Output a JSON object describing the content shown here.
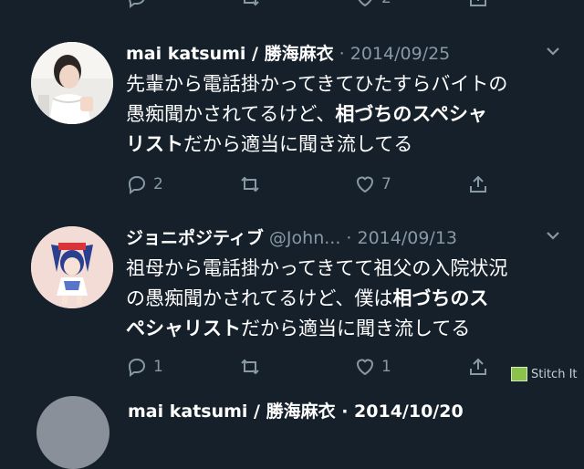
{
  "top_partial": {
    "like_count": "2"
  },
  "tweets": [
    {
      "name": "mai katsumi / 勝海麻衣",
      "handle": "",
      "date": "· 2014/09/25",
      "body": {
        "line1": "先輩から電話掛かってきてひたすらバイトの",
        "line2_plain": "愚痴聞かされてるけど、",
        "line2_bold": "相づちのスペシャ",
        "line3_bold": "リスト",
        "line3_plain": "だから適当に聞き流してる"
      },
      "reply_count": "2",
      "retweet_count": "",
      "like_count": "7"
    },
    {
      "name": "ジョニポジティブ",
      "handle": "@John...",
      "date": "· 2014/09/13",
      "body": {
        "line1": "祖母から電話掛かってきてて祖父の入院状況",
        "line2_plain": "の愚痴聞かされてるけど、僕は",
        "line2_bold": "相づちのス",
        "line3_bold": "ペシャリスト",
        "line3_plain": "だから適当に聞き流してる"
      },
      "reply_count": "1",
      "retweet_count": "",
      "like_count": "1"
    }
  ],
  "bottom_partial": {
    "text": "mai katsumi / 勝海麻衣 · 2014/10/20"
  },
  "watermark": {
    "label": "Stitch It"
  },
  "icons": {
    "reply": "reply-icon",
    "retweet": "retweet-icon",
    "like": "heart-icon",
    "share": "share-icon",
    "menu": "chevron-down-icon"
  },
  "colors": {
    "background": "#15202b",
    "secondary_text": "#8899a6",
    "primary_text": "#ffffff"
  }
}
